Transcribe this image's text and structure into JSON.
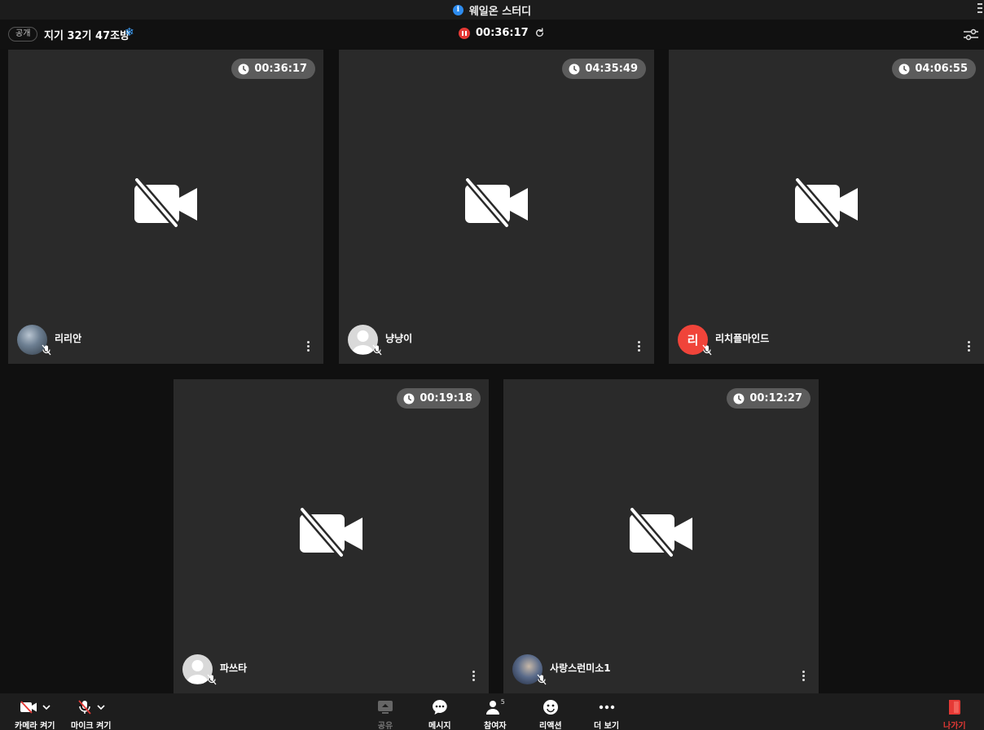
{
  "window": {
    "title": "웨일온 스터디"
  },
  "room": {
    "visibility": "공개",
    "name": "지기 32기 47조방",
    "elapsed": "00:36:17"
  },
  "participants": [
    {
      "name": "리리안",
      "time": "00:36:17",
      "avatar_type": "photo"
    },
    {
      "name": "냥냥이",
      "time": "04:35:49",
      "avatar_type": "default"
    },
    {
      "name": "리치플마인드",
      "time": "04:06:55",
      "avatar_type": "initial",
      "initial": "리",
      "avatar_color": "#f0443a"
    },
    {
      "name": "파쓰타",
      "time": "00:19:18",
      "avatar_type": "default"
    },
    {
      "name": "사랑스런미소1",
      "time": "00:12:27",
      "avatar_type": "photo"
    }
  ],
  "toolbar": {
    "camera": {
      "label": "카메라 켜기",
      "icon": "camera-off-icon"
    },
    "mic": {
      "label": "마이크 켜기",
      "icon": "mic-off-icon"
    },
    "share": {
      "label": "공유",
      "icon": "screen-share-icon",
      "enabled": false
    },
    "message": {
      "label": "메시지",
      "icon": "chat-bubble-icon"
    },
    "participants": {
      "label": "참여자",
      "count": "5",
      "icon": "person-icon"
    },
    "reaction": {
      "label": "리액션",
      "icon": "smiley-icon"
    },
    "more": {
      "label": "더 보기",
      "icon": "more-dots-icon"
    },
    "leave": {
      "label": "나가기",
      "icon": "exit-door-icon"
    }
  },
  "colors": {
    "accent": "#2d8cf0",
    "record": "#e53935",
    "leave": "#e53935",
    "tile_bg": "#2a2a2a"
  }
}
